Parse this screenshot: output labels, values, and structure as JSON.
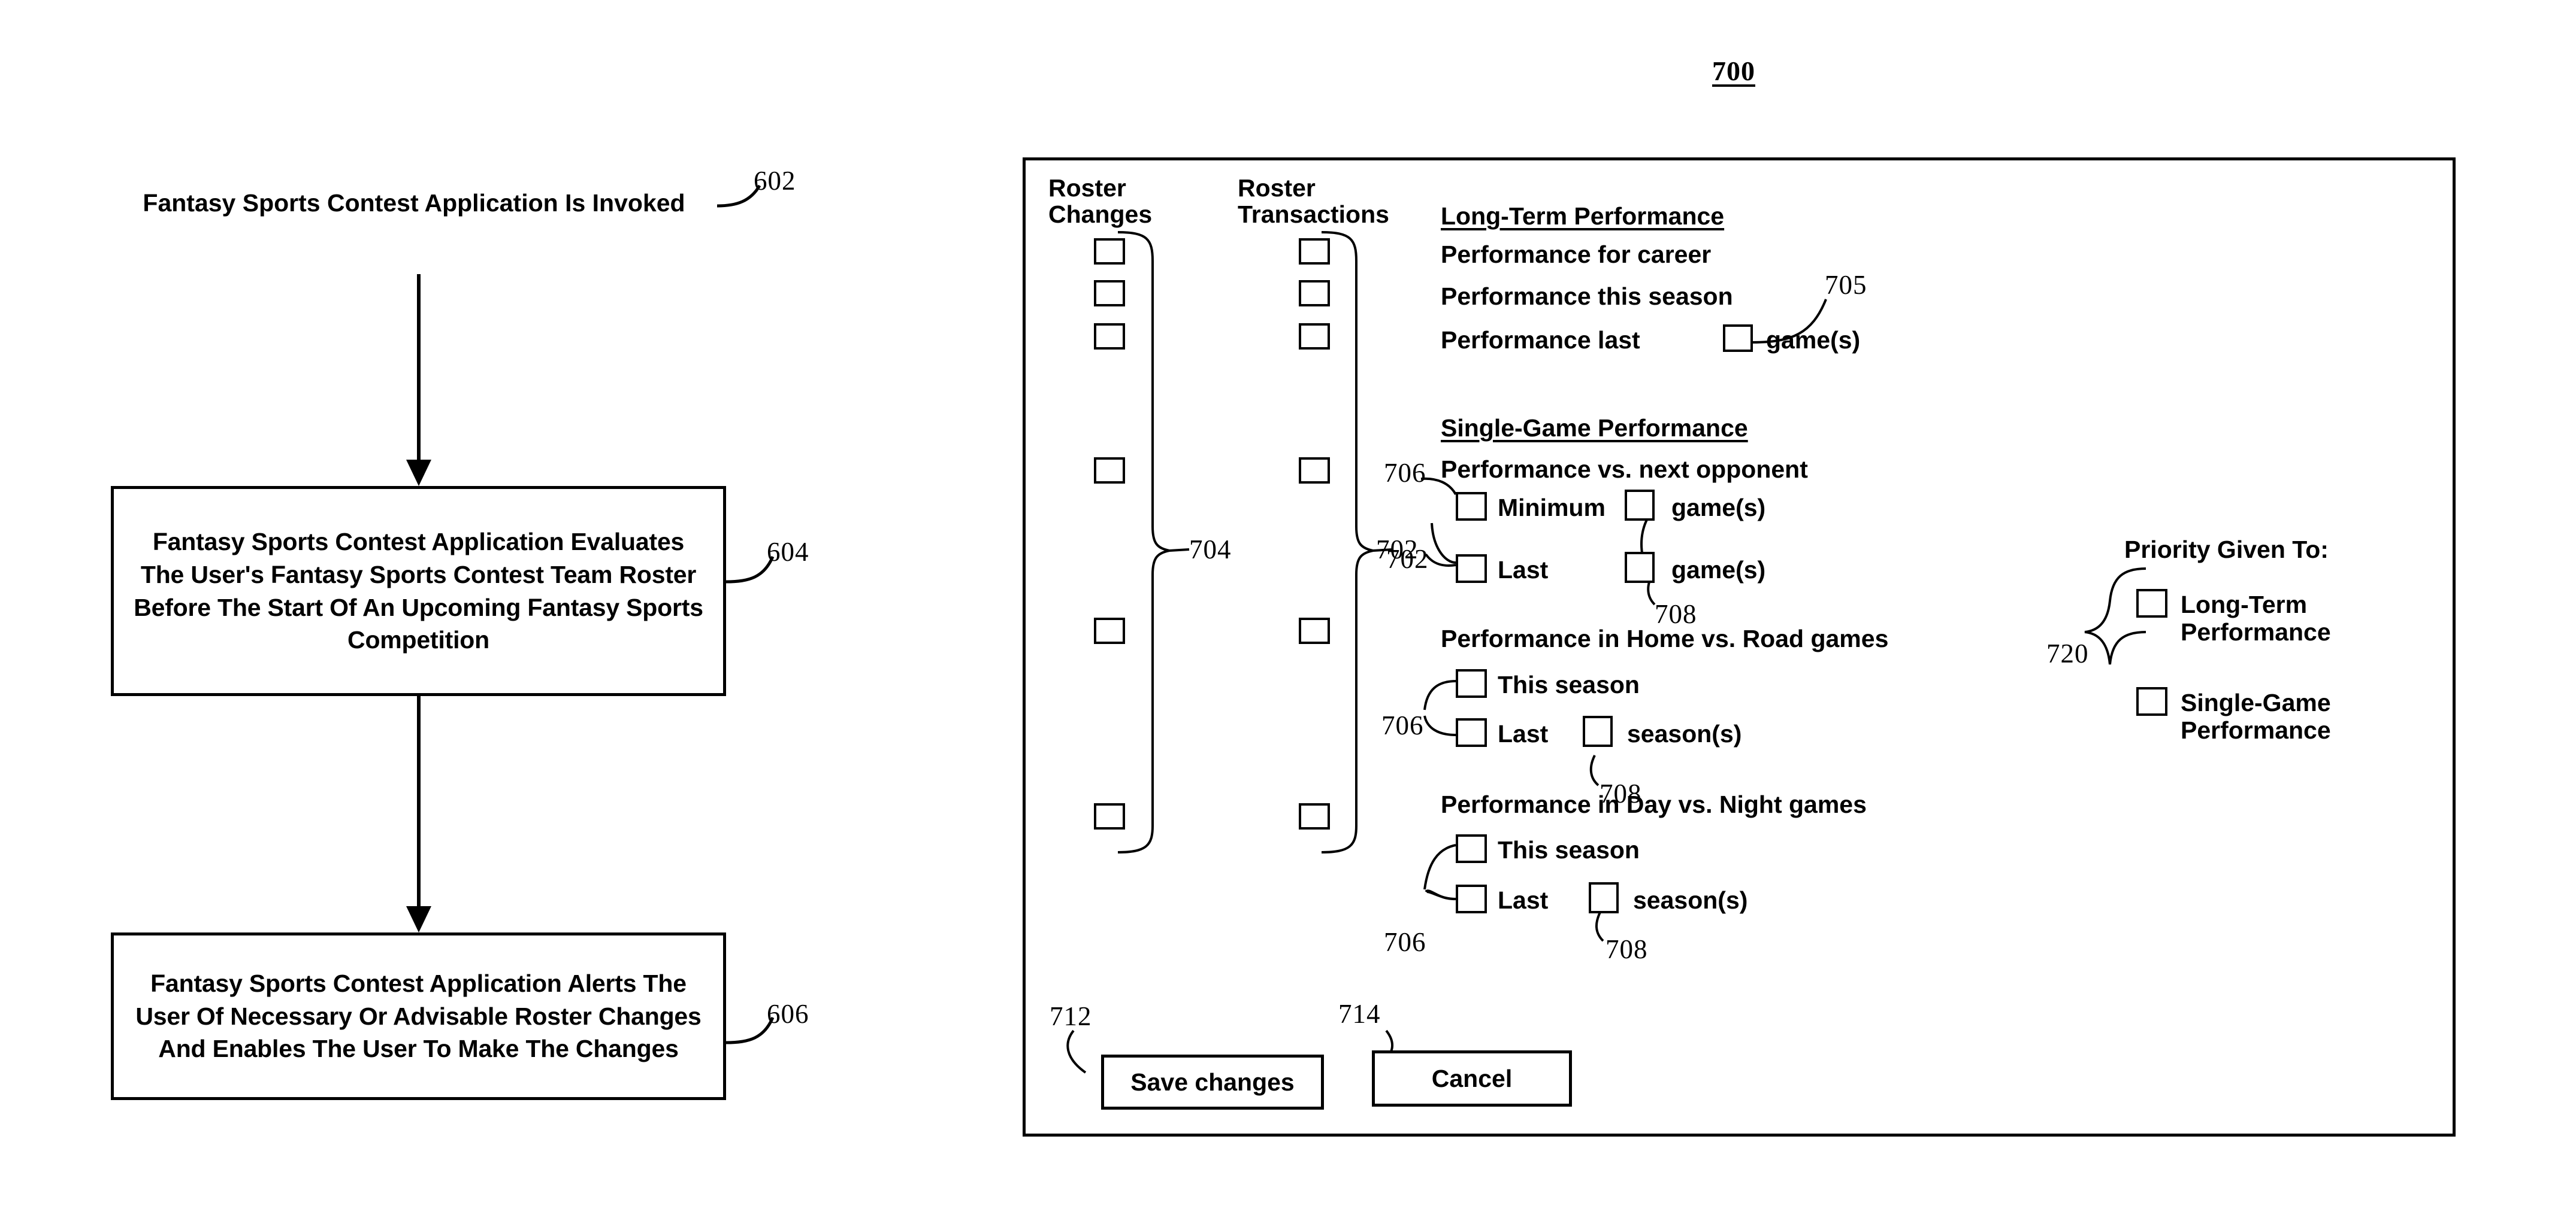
{
  "figure": {
    "number": "700"
  },
  "flowchart": {
    "steps": [
      {
        "id": "602",
        "text": "Fantasy Sports Contest Application Is Invoked",
        "ref": "602"
      },
      {
        "id": "604",
        "text": "Fantasy Sports Contest Application Evaluates The User's Fantasy Sports Contest Team Roster Before The Start Of An Upcoming Fantasy Sports Competition",
        "ref": "604"
      },
      {
        "id": "606",
        "text": "Fantasy Sports Contest Application Alerts The User Of Necessary Or Advisable Roster Changes And Enables The User To Make The Changes",
        "ref": "606"
      }
    ]
  },
  "panel": {
    "columns": {
      "roster_changes": "Roster\nChanges",
      "roster_transactions": "Roster\nTransactions"
    },
    "brace_refs": {
      "roster_changes": "704",
      "roster_transactions": "702"
    },
    "sections": [
      {
        "heading": "Long-Term Performance",
        "items": [
          {
            "label": "Performance for career"
          },
          {
            "label": "Performance this season"
          },
          {
            "label_before": "Performance last",
            "label_after": "game(s)",
            "inline_box_ref": "705"
          }
        ]
      },
      {
        "heading": "Single-Game Performance",
        "items": [
          {
            "label": "Performance vs. next opponent"
          },
          {
            "label": "Minimum",
            "label_after": "game(s)",
            "box_ref": "706",
            "inline_box_ref": "708"
          },
          {
            "label": "Last",
            "label_after": "game(s)",
            "box_ref": "706",
            "inline_box_ref": "708"
          }
        ]
      },
      {
        "heading": "Performance in Home vs. Road games",
        "items": [
          {
            "label": "This season",
            "box_ref": "706"
          },
          {
            "label": "Last",
            "label_after": "season(s)",
            "box_ref": "706",
            "inline_box_ref": "708"
          }
        ]
      },
      {
        "heading": "Performance in Day vs. Night games",
        "items": [
          {
            "label": "This season",
            "box_ref": "706"
          },
          {
            "label": "Last",
            "label_after": "season(s)",
            "box_ref": "706",
            "inline_box_ref": "708"
          }
        ]
      }
    ],
    "priority": {
      "title": "Priority Given To:",
      "ref": "720",
      "options": [
        {
          "label": "Long-Term\nPerformance"
        },
        {
          "label": "Single-Game\nPerformance"
        }
      ]
    },
    "buttons": {
      "save": {
        "label": "Save changes",
        "ref": "712"
      },
      "cancel": {
        "label": "Cancel",
        "ref": "714"
      }
    },
    "refs": {
      "r702": "702",
      "r704": "704",
      "r705": "705",
      "r706a": "706",
      "r706b": "706",
      "r706c": "706",
      "r708a": "708",
      "r708b": "708",
      "r708c": "708",
      "r712": "712",
      "r714": "714",
      "r720": "720"
    }
  }
}
